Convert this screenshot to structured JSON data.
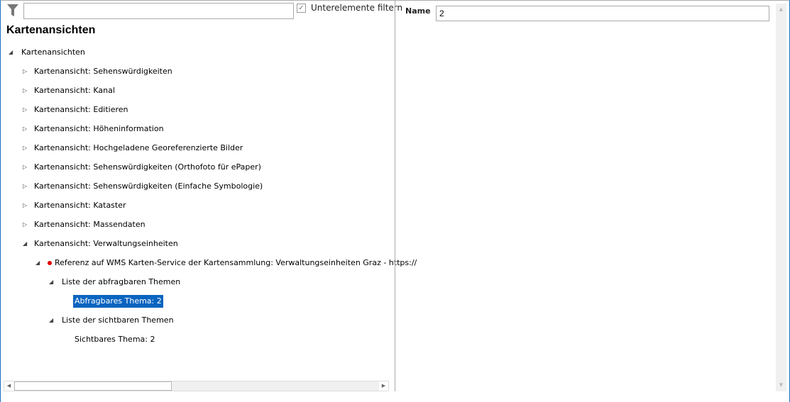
{
  "filter": {
    "value": "",
    "checkbox_label": "Unterelemente filtern",
    "checked": true
  },
  "left": {
    "title": "Kartenansichten"
  },
  "tree": [
    {
      "label": "Kartenansichten",
      "level": 0,
      "state": "open"
    },
    {
      "label": "Kartenansicht: Sehenswürdigkeiten",
      "level": 1,
      "state": "closed"
    },
    {
      "label": "Kartenansicht: Kanal",
      "level": 1,
      "state": "closed"
    },
    {
      "label": "Kartenansicht: Editieren",
      "level": 1,
      "state": "closed"
    },
    {
      "label": "Kartenansicht: Höheninformation",
      "level": 1,
      "state": "closed"
    },
    {
      "label": "Kartenansicht: Hochgeladene Georeferenzierte Bilder",
      "level": 1,
      "state": "closed"
    },
    {
      "label": "Kartenansicht: Sehenswürdigkeiten (Orthofoto für ePaper)",
      "level": 1,
      "state": "closed"
    },
    {
      "label": "Kartenansicht: Sehenswürdigkeiten (Einfache Symbologie)",
      "level": 1,
      "state": "closed"
    },
    {
      "label": "Kartenansicht: Kataster",
      "level": 1,
      "state": "closed"
    },
    {
      "label": "Kartenansicht: Massendaten",
      "level": 1,
      "state": "closed"
    },
    {
      "label": "Kartenansicht: Verwaltungseinheiten",
      "level": 1,
      "state": "open"
    },
    {
      "label": "Referenz auf WMS Karten-Service der Kartensammlung: Verwaltungseinheiten Graz - https://",
      "level": 2,
      "state": "open",
      "dot": true
    },
    {
      "label": "Liste der abfragbaren Themen",
      "level": 3,
      "state": "open"
    },
    {
      "label": "Abfragbares Thema: 2",
      "level": 4,
      "state": "leaf",
      "selected": true
    },
    {
      "label": "Liste der sichtbaren Themen",
      "level": 3,
      "state": "open"
    },
    {
      "label": "Sichtbares Thema: 2",
      "level": 4,
      "state": "leaf"
    }
  ],
  "details": {
    "name_label": "Name",
    "name_value": "2"
  },
  "colors": {
    "selection": "#0a64c0",
    "dot": "#e00000",
    "border": "#1a6fc0"
  }
}
